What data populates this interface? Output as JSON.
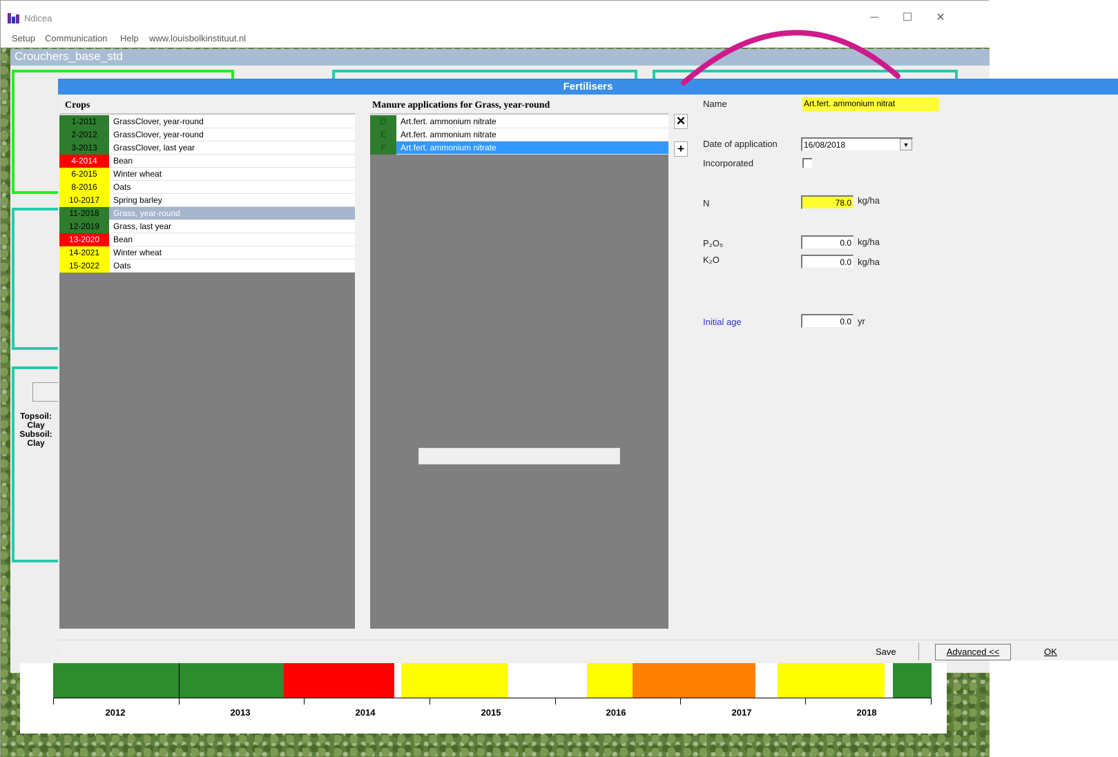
{
  "app": {
    "title": "Ndicea",
    "menu": [
      "Setup",
      "Communication",
      "Help",
      "www.louisbolkinstituut.nl"
    ],
    "project_name": "Crouchers_base_std",
    "soil_text": "Topsoil:\nClay\nSubsoil:\nClay",
    "icons": {
      "minimize": "─",
      "maximize": "☐",
      "close": "✕"
    }
  },
  "timeline": {
    "years": [
      "2012",
      "2013",
      "2014",
      "2015",
      "2016",
      "2017",
      "2018"
    ],
    "segment_colors": {
      "green": "#2e8b2e",
      "red": "#ff0000",
      "yellow": "#ffff00",
      "white": "#ffffff",
      "orange": "#ff8000"
    }
  },
  "dialog": {
    "title": "Fertilisers",
    "crops_header": "Crops",
    "crops": [
      {
        "tag": "1-2011",
        "name": "GrassClover, year-round",
        "color": "green",
        "selected": false
      },
      {
        "tag": "2-2012",
        "name": "GrassClover, year-round",
        "color": "green",
        "selected": false
      },
      {
        "tag": "3-2013",
        "name": "GrassClover, last year",
        "color": "green",
        "selected": false
      },
      {
        "tag": "4-2014",
        "name": "Bean",
        "color": "red",
        "selected": false
      },
      {
        "tag": "6-2015",
        "name": "Winter wheat",
        "color": "yellow",
        "selected": false
      },
      {
        "tag": "8-2016",
        "name": "Oats",
        "color": "yellow",
        "selected": false
      },
      {
        "tag": "10-2017",
        "name": "Spring barley",
        "color": "yellow",
        "selected": false
      },
      {
        "tag": "11-2018",
        "name": "Grass, year-round",
        "color": "green",
        "selected": true
      },
      {
        "tag": "12-2019",
        "name": "Grass, last year",
        "color": "green",
        "selected": false
      },
      {
        "tag": "13-2020",
        "name": "Bean",
        "color": "red",
        "selected": false
      },
      {
        "tag": "14-2021",
        "name": "Winter wheat",
        "color": "yellow",
        "selected": false
      },
      {
        "tag": "15-2022",
        "name": "Oats",
        "color": "yellow",
        "selected": false
      }
    ],
    "manure_header": "Manure applications for Grass, year-round",
    "manure": [
      {
        "tag": "D",
        "name": "Art.fert. ammonium nitrate",
        "selected": false
      },
      {
        "tag": "E",
        "name": "Art.fert. ammonium nitrate",
        "selected": false
      },
      {
        "tag": "F",
        "name": "Art.fert. ammonium nitrate",
        "selected": true
      }
    ],
    "delete_label": "✕",
    "add_label": "+",
    "form": {
      "name_label": "Name",
      "name_value": "Art.fert. ammonium nitrat",
      "date_label": "Date of application",
      "date_value": "16/08/2018",
      "incorporated_label": "Incorporated",
      "n_label": "N",
      "n_value": "78.0",
      "p2o5_label": "P₂O₅",
      "p2o5_value": "0.0",
      "k2o_label": "K₂O",
      "k2o_value": "0.0",
      "unit_kgha": "kg/ha",
      "initial_age_label": "Initial age",
      "initial_age_value": "0.0",
      "unit_yr": "yr"
    },
    "footer": {
      "save": "Save",
      "advanced": "Advanced <<",
      "ok": "OK"
    }
  },
  "colors": {
    "tag_green": "#2e7d2e",
    "tag_red": "#ff0000",
    "tag_yellow": "#ffff00",
    "highlight_yellow": "#ffff33",
    "annotation_arc": "#d01a8c"
  }
}
